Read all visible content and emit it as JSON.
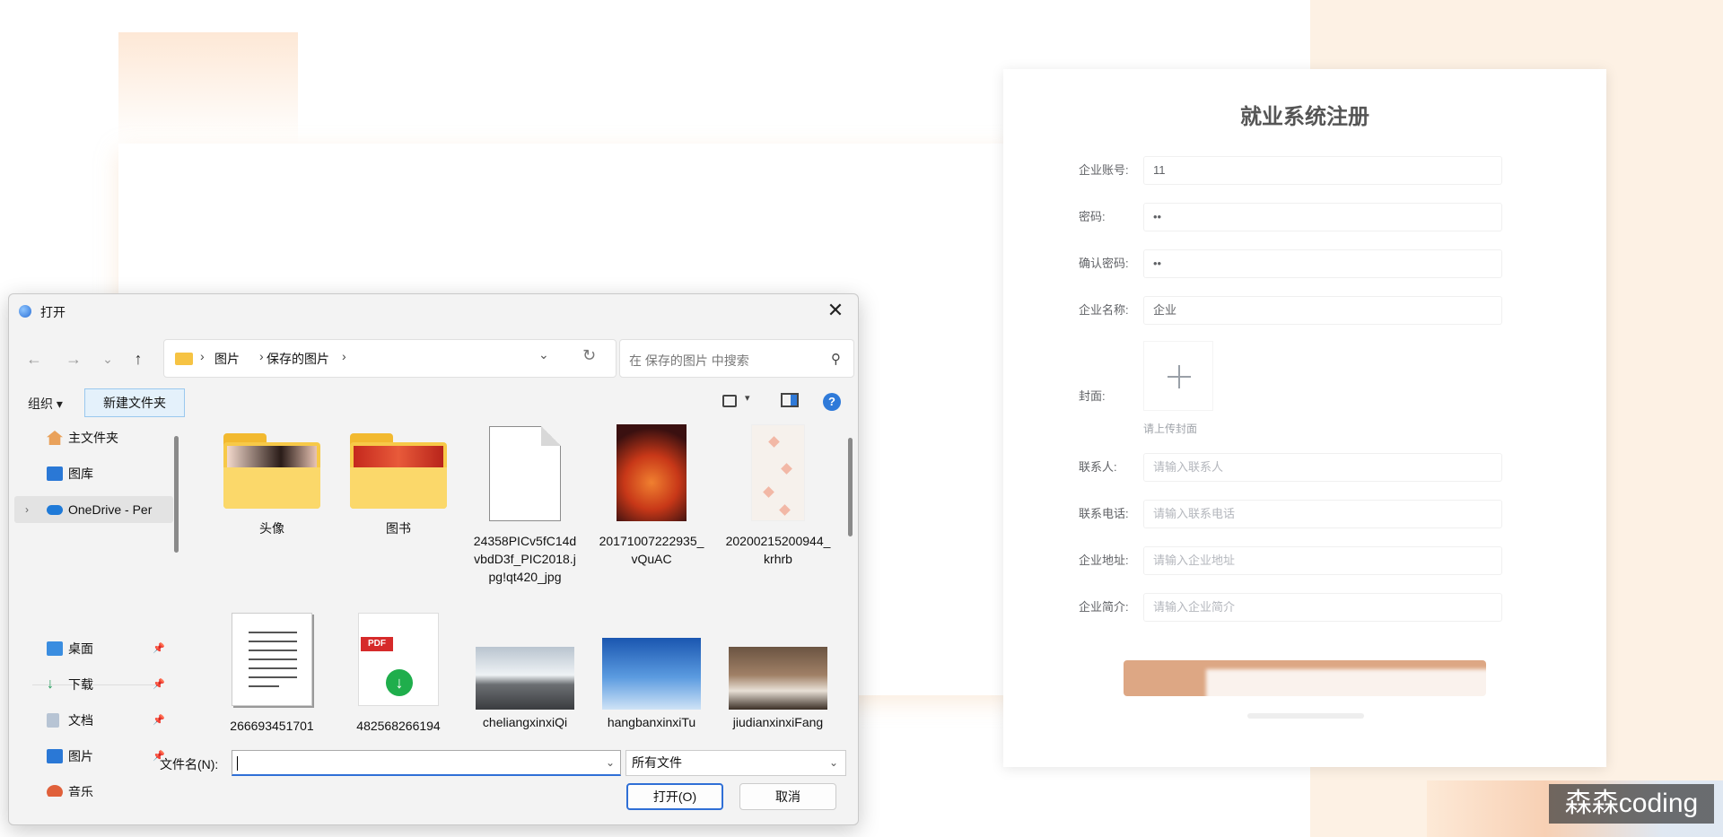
{
  "register": {
    "title": "就业系统注册",
    "fields": [
      {
        "label": "企业账号:",
        "value": "11",
        "placeholder": ""
      },
      {
        "label": "密码:",
        "value": "••",
        "placeholder": ""
      },
      {
        "label": "确认密码:",
        "value": "••",
        "placeholder": ""
      },
      {
        "label": "企业名称:",
        "value": "企业",
        "placeholder": ""
      }
    ],
    "cover_label": "封面:",
    "cover_tip": "请上传封面",
    "fields2": [
      {
        "label": "联系人:",
        "placeholder": "请输入联系人"
      },
      {
        "label": "联系电话:",
        "placeholder": "请输入联系电话"
      },
      {
        "label": "企业地址:",
        "placeholder": "请输入企业地址"
      },
      {
        "label": "企业简介:",
        "placeholder": "请输入企业简介"
      }
    ],
    "accent": "#dda784"
  },
  "watermark": "森森coding",
  "dialog": {
    "title": "打开",
    "close_glyph": "✕",
    "nav": {
      "back": "←",
      "forward": "→",
      "recent": "⌄",
      "up": "↑"
    },
    "breadcrumb": [
      "图片",
      "保存的图片"
    ],
    "search_placeholder": "在 保存的图片 中搜索",
    "toolbar": {
      "organize": "组织 ▾",
      "new_folder": "新建文件夹",
      "help": "?"
    },
    "sidebar": {
      "top": [
        {
          "label": "主文件夹",
          "icon": "home-icon"
        },
        {
          "label": "图库",
          "icon": "gallery-icon"
        },
        {
          "label": "OneDrive - Per",
          "icon": "onedrive-icon"
        }
      ],
      "pinned": [
        {
          "label": "桌面",
          "icon": "desktop-icon"
        },
        {
          "label": "下载",
          "icon": "download-icon"
        },
        {
          "label": "文档",
          "icon": "document-icon"
        },
        {
          "label": "图片",
          "icon": "pictures-icon"
        },
        {
          "label": "音乐",
          "icon": "music-icon"
        }
      ]
    },
    "files": [
      {
        "name": "头像",
        "kind": "folder"
      },
      {
        "name": "图书",
        "kind": "folder"
      },
      {
        "name": "24358PICv5fC14dvbdD3f_PIC2018.jpg!qt420_jpg",
        "kind": "blank"
      },
      {
        "name": "20171007222935_vQuAC",
        "kind": "image"
      },
      {
        "name": "20200215200944_krhrb",
        "kind": "image"
      },
      {
        "name": "266693451701",
        "kind": "text"
      },
      {
        "name": "482568266194",
        "kind": "pdf"
      },
      {
        "name": "cheliangxinxiQi",
        "kind": "image"
      },
      {
        "name": "hangbanxinxiTu",
        "kind": "image"
      },
      {
        "name": "jiudianxinxiFang",
        "kind": "image"
      }
    ],
    "filename_label": "文件名(N):",
    "filename_value": "",
    "filetype": "所有文件",
    "open_button": "打开(O)",
    "cancel_button": "取消"
  }
}
